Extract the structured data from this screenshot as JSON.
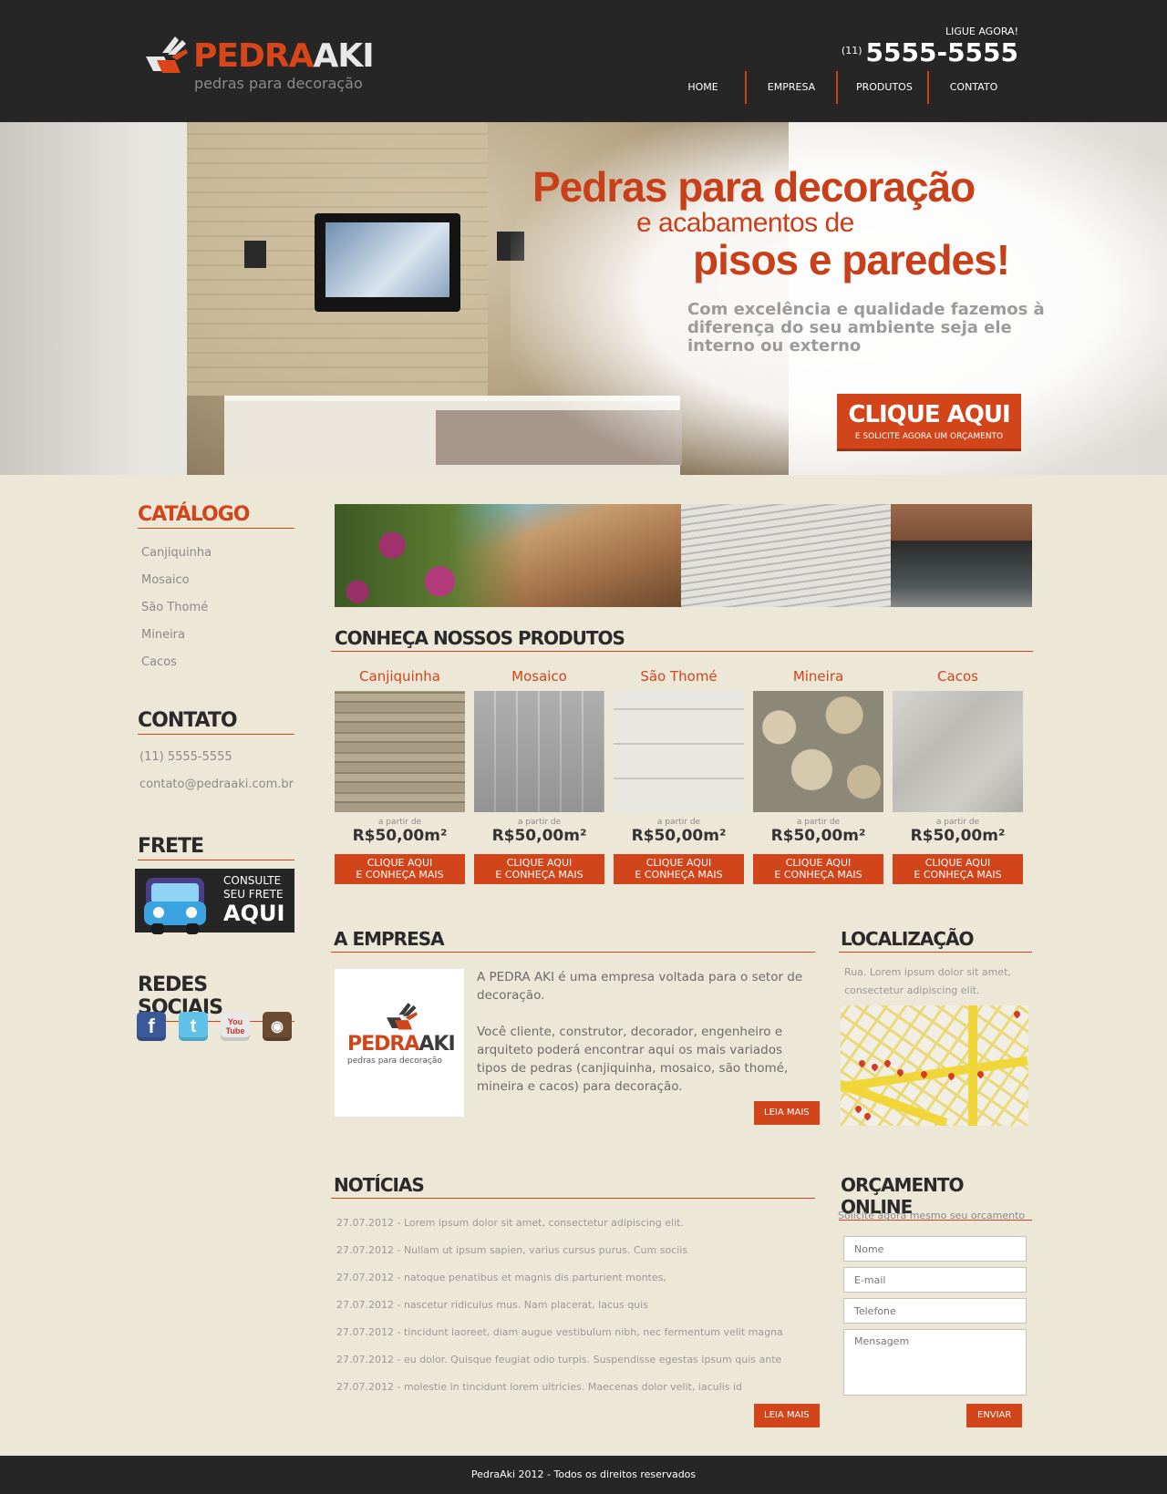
{
  "header": {
    "logo_primary": "PEDRA",
    "logo_secondary": "AKI",
    "logo_tagline": "pedras para decoração",
    "call_label": "LIGUE AGORA!",
    "call_area": "(11)",
    "call_number": "5555-5555",
    "nav": [
      "HOME",
      "EMPRESA",
      "PRODUTOS",
      "CONTATO"
    ]
  },
  "hero": {
    "line1": "Pedras para decoração",
    "line2": "e acabamentos de",
    "line3": "pisos e paredes!",
    "paragraph": "Com excelência e qualidade fazemos à diferença do seu ambiente seja ele interno ou externo",
    "cta_big": "CLIQUE AQUI",
    "cta_small": "E SOLICITE AGORA UM ORÇAMENTO"
  },
  "sidebar": {
    "catalog_title": "CATÁLOGO",
    "catalog_items": [
      "Canjiquinha",
      "Mosaico",
      "São Thomé",
      "Mineira",
      "Cacos"
    ],
    "contact_title": "CONTATO",
    "contact_phone": "(11) 5555-5555",
    "contact_email": "contato@pedraaki.com.br",
    "frete_title": "FRETE",
    "frete_line1": "CONSULTE",
    "frete_line2": "SEU FRETE",
    "frete_line3": "AQUI",
    "social_title": "REDES SOCIAIS",
    "social": [
      {
        "icon": "facebook-icon",
        "glyph": "f"
      },
      {
        "icon": "twitter-icon",
        "glyph": "t"
      },
      {
        "icon": "youtube-icon",
        "glyph": "You\nTube"
      },
      {
        "icon": "instagram-icon",
        "glyph": "◉"
      }
    ]
  },
  "products": {
    "title": "CONHEÇA NOSSOS PRODUTOS",
    "from_label": "a partir de",
    "button_line1": "CLIQUE AQUI",
    "button_line2": "E CONHEÇA MAIS",
    "items": [
      {
        "name": "Canjiquinha",
        "price": "R$50,00m²"
      },
      {
        "name": "Mosaico",
        "price": "R$50,00m²"
      },
      {
        "name": "São Thomé",
        "price": "R$50,00m²"
      },
      {
        "name": "Mineira",
        "price": "R$50,00m²"
      },
      {
        "name": "Cacos",
        "price": "R$50,00m²"
      }
    ]
  },
  "empresa": {
    "title": "A EMPRESA",
    "logo_primary": "PEDRA",
    "logo_secondary": "AKI",
    "logo_tagline": "pedras para decoração",
    "para1": "A PEDRA AKI é uma empresa voltada para o setor de decoração.",
    "para2": "Você cliente, construtor, decorador, engenheiro e arquiteto poderá encontrar aqui os mais variados tipos de pedras (canjiquinha, mosaico, são thomé, mineira e cacos) para decoração.",
    "more": "LEIA MAIS"
  },
  "localizacao": {
    "title": "LOCALIZAÇÃO",
    "address": "Rua. Lorem ipsum dolor sit amet, consectetur adipiscing elit."
  },
  "noticias": {
    "title": "NOTÍCIAS",
    "items": [
      "27.07.2012 - Lorem ipsum dolor sit amet, consectetur adipiscing elit.",
      "27.07.2012 - Nullam ut ipsum sapien, varius cursus purus. Cum sociis",
      "27.07.2012 - natoque penatibus et magnis dis parturient montes,",
      "27.07.2012 - nascetur ridiculus mus. Nam placerat, lacus quis",
      "27.07.2012 - tincidunt laoreet, diam augue vestibulum nibh, nec fermentum velit magna",
      "27.07.2012 - eu dolor. Quisque feugiat odio turpis. Suspendisse egestas ipsum quis ante",
      "27.07.2012 - molestie in tincidunt lorem ultricies. Maecenas dolor velit, iaculis id"
    ],
    "more": "LEIA MAIS"
  },
  "orcamento": {
    "title": "ORÇAMENTO ONLINE",
    "subtitle": "Solicite agora mesmo seu orçamento",
    "name_placeholder": "Nome",
    "email_placeholder": "E-mail",
    "phone_placeholder": "Telefone",
    "message_placeholder": "Mensagem",
    "submit": "ENVIAR"
  },
  "footer": {
    "text": "PedraAki 2012 - Todos os direitos reservados"
  },
  "colors": {
    "accent": "#d2441a",
    "header_bg": "#262626",
    "page_bg": "#ede7d8"
  }
}
